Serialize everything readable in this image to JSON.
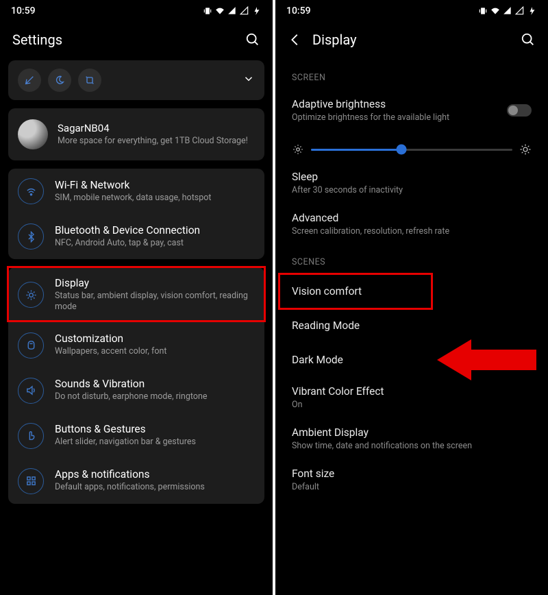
{
  "left": {
    "time": "10:59",
    "header_title": "Settings",
    "profile": {
      "name": "SagarNB04",
      "sub": "More space for everything, get 1TB Cloud Storage!"
    },
    "items": [
      {
        "title": "Wi-Fi & Network",
        "sub": "SIM, mobile network, data usage, hotspot"
      },
      {
        "title": "Bluetooth & Device Connection",
        "sub": "NFC, Android Auto, tap & pay, cast"
      },
      {
        "title": "Display",
        "sub": "Status bar, ambient display, vision comfort, reading mode"
      },
      {
        "title": "Customization",
        "sub": "Wallpapers, accent color, font"
      },
      {
        "title": "Sounds & Vibration",
        "sub": "Do not disturb, earphone mode, ringtone"
      },
      {
        "title": "Buttons & Gestures",
        "sub": "Alert slider, navigation bar & gestures"
      },
      {
        "title": "Apps & notifications",
        "sub": "Default apps, notifications, permissions"
      }
    ]
  },
  "right": {
    "time": "10:59",
    "header_title": "Display",
    "section_screen": "SCREEN",
    "adaptive": {
      "title": "Adaptive brightness",
      "sub": "Optimize brightness for the available light"
    },
    "sleep": {
      "title": "Sleep",
      "sub": "After 30 seconds of inactivity"
    },
    "advanced": {
      "title": "Advanced",
      "sub": "Screen calibration, resolution, refresh rate"
    },
    "section_scenes": "SCENES",
    "vision": "Vision comfort",
    "reading": "Reading Mode",
    "dark": "Dark Mode",
    "vibrant": {
      "title": "Vibrant Color Effect",
      "sub": "On"
    },
    "ambient": {
      "title": "Ambient Display",
      "sub": "Show time, date and notifications on the screen"
    },
    "fontsize": {
      "title": "Font size",
      "sub": "Default"
    }
  }
}
